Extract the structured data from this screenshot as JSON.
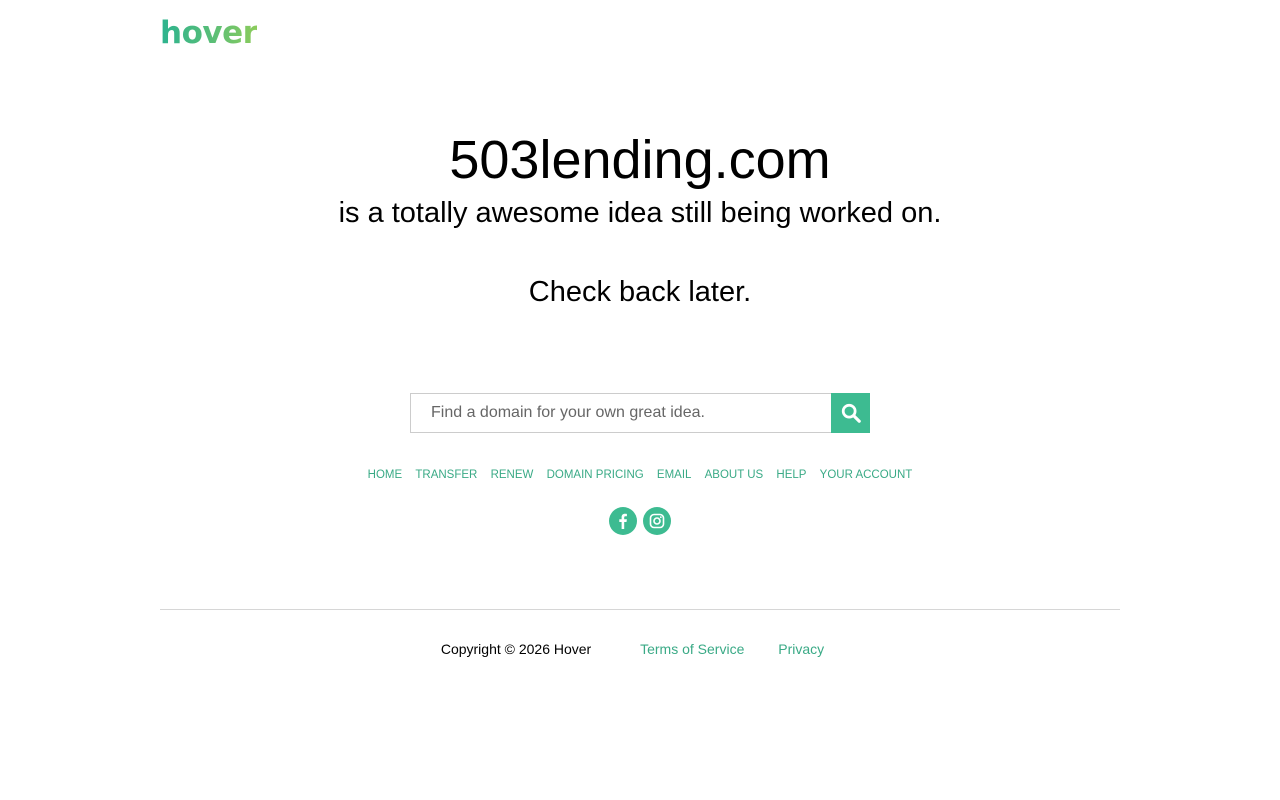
{
  "brand": {
    "logo_text": "hover",
    "accent_color": "#3dbb91"
  },
  "hero": {
    "domain": "503lending.com",
    "tagline": "is a totally awesome idea still being worked on.",
    "check_back": "Check back later."
  },
  "search": {
    "placeholder": "Find a domain for your own great idea.",
    "value": "",
    "button_icon": "search-icon"
  },
  "nav": {
    "items": [
      {
        "label": "HOME"
      },
      {
        "label": "TRANSFER"
      },
      {
        "label": "RENEW"
      },
      {
        "label": "DOMAIN PRICING"
      },
      {
        "label": "EMAIL"
      },
      {
        "label": "ABOUT US"
      },
      {
        "label": "HELP"
      },
      {
        "label": "YOUR ACCOUNT"
      }
    ]
  },
  "social": {
    "icons": [
      "facebook-icon",
      "instagram-icon"
    ]
  },
  "footer": {
    "copyright": "Copyright © 2026 Hover",
    "terms": "Terms of Service",
    "privacy": "Privacy"
  }
}
